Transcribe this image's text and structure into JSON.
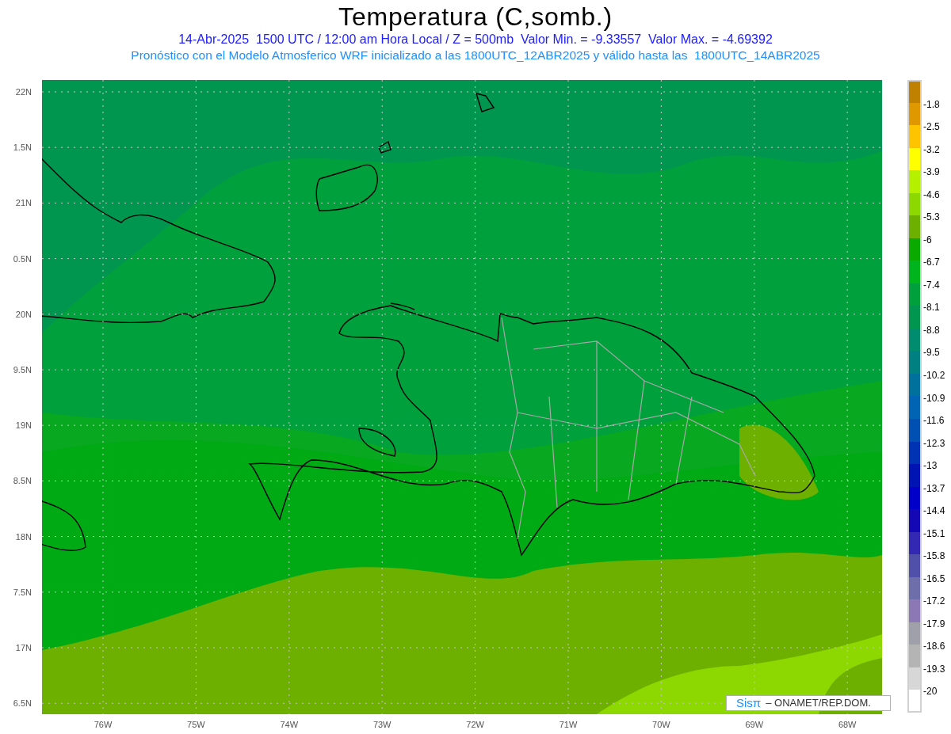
{
  "title": "Temperatura (C,somb.)",
  "subtitle": "14-Abr-2025  1500 UTC / 12:00 am Hora Local / Z = 500mb  Valor Min. = -9.33557  Valor Max. = -4.69392",
  "model_note": "Pronóstico con el Modelo Atmosferico WRF inicializado a las 1800UTC_12ABR2025 y válido hasta las  1800UTC_14ABR2025",
  "y_ticks": [
    "22N",
    "1.5N",
    "21N",
    "0.5N",
    "20N",
    "9.5N",
    "19N",
    "8.5N",
    "18N",
    "7.5N",
    "17N",
    "6.5N"
  ],
  "x_ticks": [
    "76W",
    "75W",
    "74W",
    "73W",
    "72W",
    "71W",
    "70W",
    "69W",
    "68W"
  ],
  "credit": {
    "logo": "Sisπ",
    "text": "– ONAMET/REP.DOM."
  },
  "legend": {
    "swatches": [
      {
        "color": "#c08000"
      },
      {
        "color": "#e09800"
      },
      {
        "color": "#ffc400"
      },
      {
        "color": "#ffff00"
      },
      {
        "color": "#b4f000"
      },
      {
        "color": "#8cd800"
      },
      {
        "color": "#6eb000"
      },
      {
        "color": "#0aaa00"
      },
      {
        "color": "#00b41e"
      },
      {
        "color": "#00a03c"
      },
      {
        "color": "#009650"
      },
      {
        "color": "#008c6e"
      },
      {
        "color": "#008080"
      },
      {
        "color": "#00709c"
      },
      {
        "color": "#0064b4"
      },
      {
        "color": "#0050b4"
      },
      {
        "color": "#0032b4"
      },
      {
        "color": "#0014b4"
      },
      {
        "color": "#0000c8"
      },
      {
        "color": "#1408b4"
      },
      {
        "color": "#3228b4"
      },
      {
        "color": "#5050aa"
      },
      {
        "color": "#6e6eaa"
      },
      {
        "color": "#8c78b4"
      },
      {
        "color": "#a0a0aa"
      },
      {
        "color": "#b4b4b4"
      },
      {
        "color": "#d7d7d7"
      },
      {
        "color": "#ffffff"
      }
    ],
    "labels": [
      "-1.8",
      "-2.5",
      "-3.2",
      "-3.9",
      "-4.6",
      "-5.3",
      "-6",
      "-6.7",
      "-7.4",
      "-8.1",
      "-8.8",
      "-9.5",
      "-10.2",
      "-10.9",
      "-11.6",
      "-12.3",
      "-13",
      "-13.7",
      "-14.4",
      "-15.1",
      "-15.8",
      "-16.5",
      "-17.2",
      "-17.9",
      "-18.6",
      "-19.3",
      "-20"
    ]
  }
}
